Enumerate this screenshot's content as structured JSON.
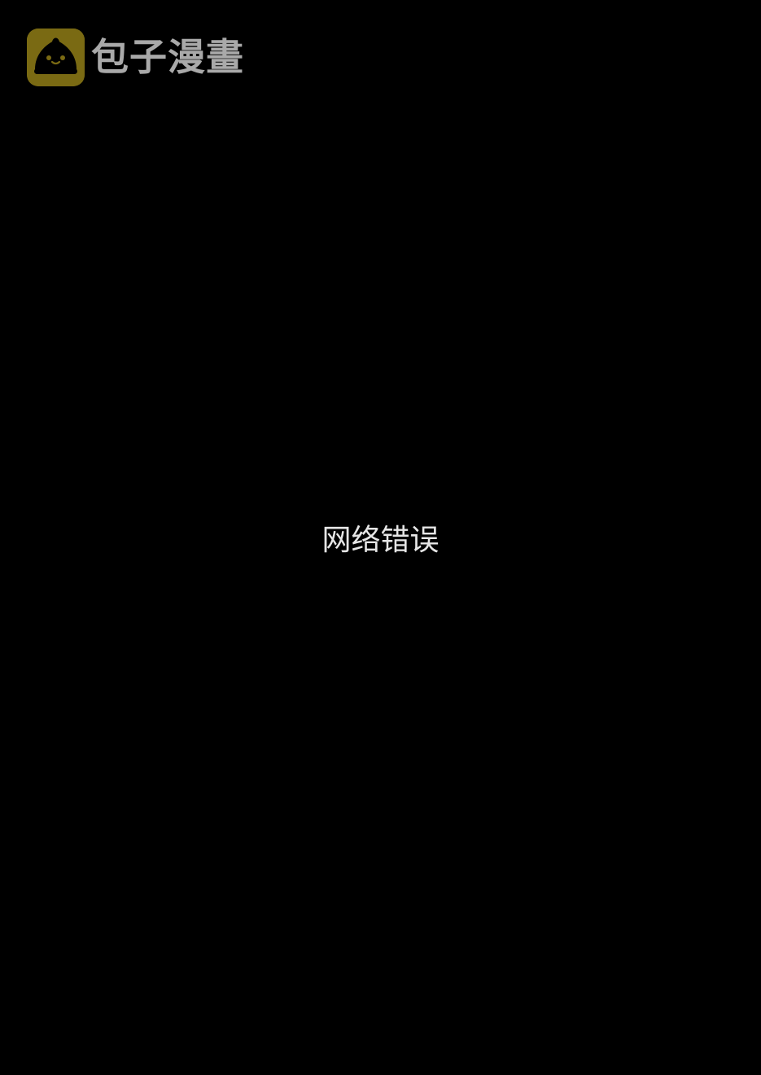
{
  "watermark": {
    "brand": "包子漫畫",
    "icon": "steamed-bun-logo-icon",
    "icon_color": "#7a6a13",
    "text_color": "#a9a9a9"
  },
  "main": {
    "error_message": "网络错误",
    "error_color": "#e6e6e6"
  },
  "background_color": "#000000"
}
